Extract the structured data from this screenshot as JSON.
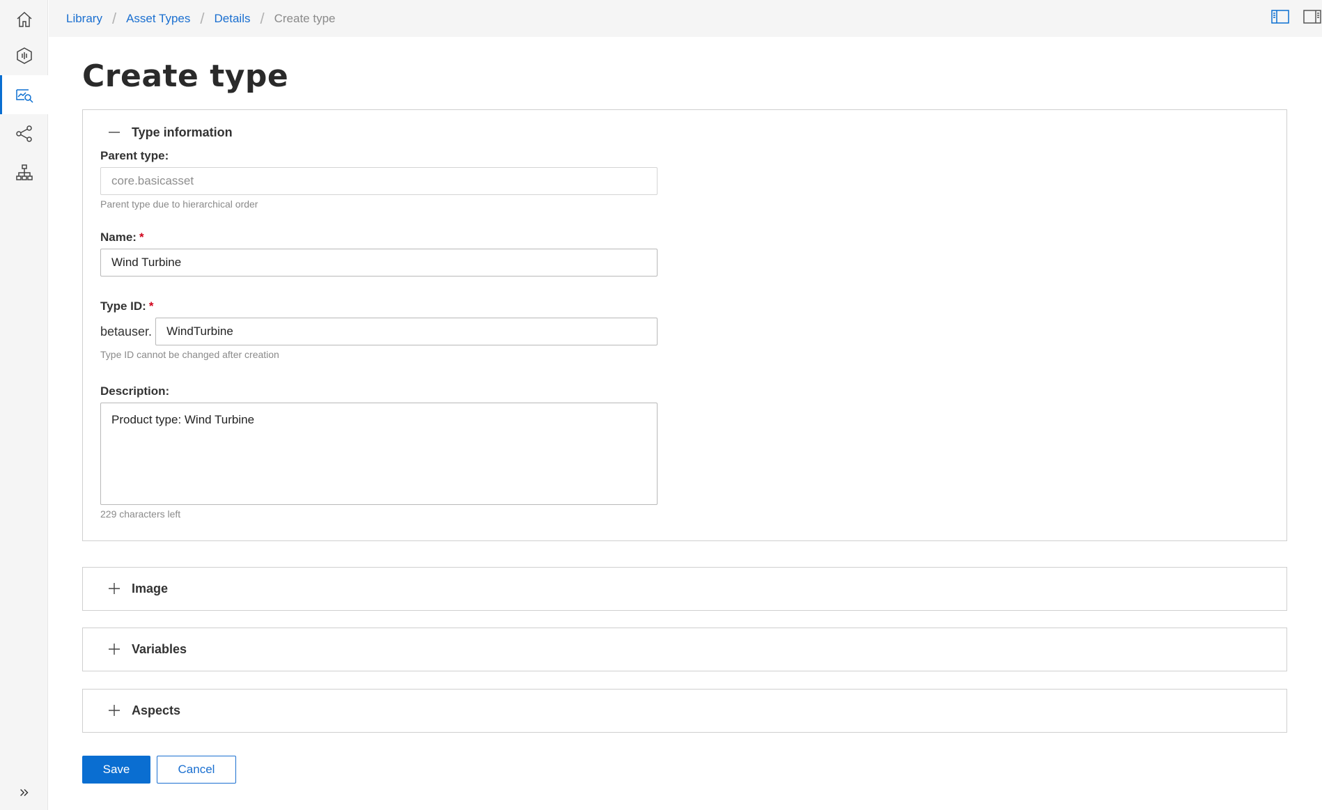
{
  "breadcrumb": {
    "items": [
      "Library",
      "Asset Types",
      "Details"
    ],
    "current": "Create type"
  },
  "page": {
    "title": "Create type"
  },
  "sections": {
    "type_information": {
      "title": "Type information",
      "expanded": true,
      "parent_type": {
        "label": "Parent type:",
        "value": "core.basicasset",
        "hint": "Parent type due to hierarchical order"
      },
      "name": {
        "label": "Name:",
        "required_mark": "*",
        "value": "Wind Turbine"
      },
      "type_id": {
        "label": "Type ID:",
        "required_mark": "*",
        "prefix": "betauser.",
        "value": "WindTurbine",
        "hint": "Type ID cannot be changed after creation"
      },
      "description": {
        "label": "Description:",
        "value": "Product type: Wind Turbine",
        "chars_left": "229 characters left"
      }
    },
    "image": {
      "title": "Image",
      "expanded": false
    },
    "variables": {
      "title": "Variables",
      "expanded": false
    },
    "aspects": {
      "title": "Aspects",
      "expanded": false
    }
  },
  "actions": {
    "save_label": "Save",
    "cancel_label": "Cancel"
  },
  "colors": {
    "accent": "#0a6ed1",
    "required": "#d0021b",
    "rail_bg": "#f5f5f5"
  },
  "icons": {
    "rail": [
      "home-icon",
      "asset-hexagon-icon",
      "analytics-search-icon",
      "share-network-icon",
      "hierarchy-icon"
    ],
    "expand": "double-chevron-right-icon",
    "layout": [
      "left-panel-layout-icon",
      "right-panel-layout-icon"
    ]
  }
}
